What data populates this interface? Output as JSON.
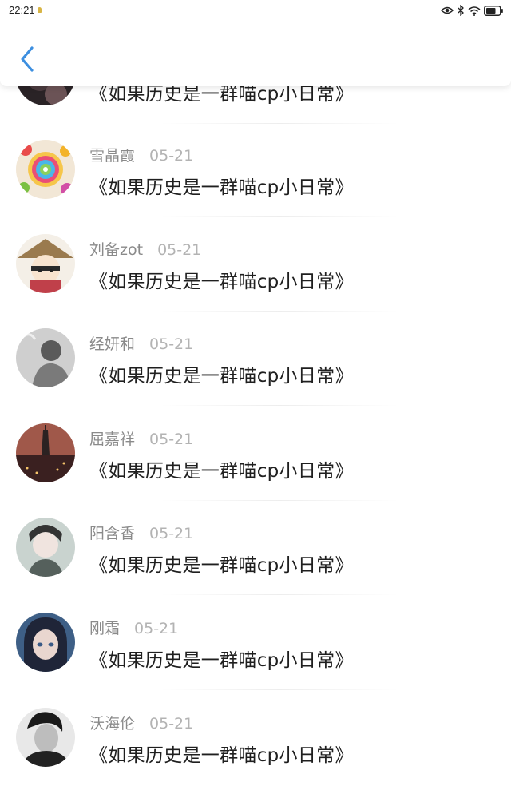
{
  "status_bar": {
    "time": "22:21",
    "icons": [
      "eye-icon",
      "bluetooth-icon",
      "wifi-icon",
      "battery-icon"
    ]
  },
  "topbar": {
    "back_icon": "chevron-left-icon",
    "accent": "#3d8fe0"
  },
  "items": [
    {
      "name": "",
      "date": "",
      "title": "《如果历史是一群喵cp小日常》"
    },
    {
      "name": "雪晶霞",
      "date": "05-21",
      "title": "《如果历史是一群喵cp小日常》"
    },
    {
      "name": "刘备zot",
      "date": "05-21",
      "title": "《如果历史是一群喵cp小日常》"
    },
    {
      "name": "经妍和",
      "date": "05-21",
      "title": "《如果历史是一群喵cp小日常》"
    },
    {
      "name": "屈嘉祥",
      "date": "05-21",
      "title": "《如果历史是一群喵cp小日常》"
    },
    {
      "name": "阳含香",
      "date": "05-21",
      "title": "《如果历史是一群喵cp小日常》"
    },
    {
      "name": "刚霜",
      "date": "05-21",
      "title": "《如果历史是一群喵cp小日常》"
    },
    {
      "name": "沃海伦",
      "date": "05-21",
      "title": "《如果历史是一群喵cp小日常》"
    }
  ]
}
